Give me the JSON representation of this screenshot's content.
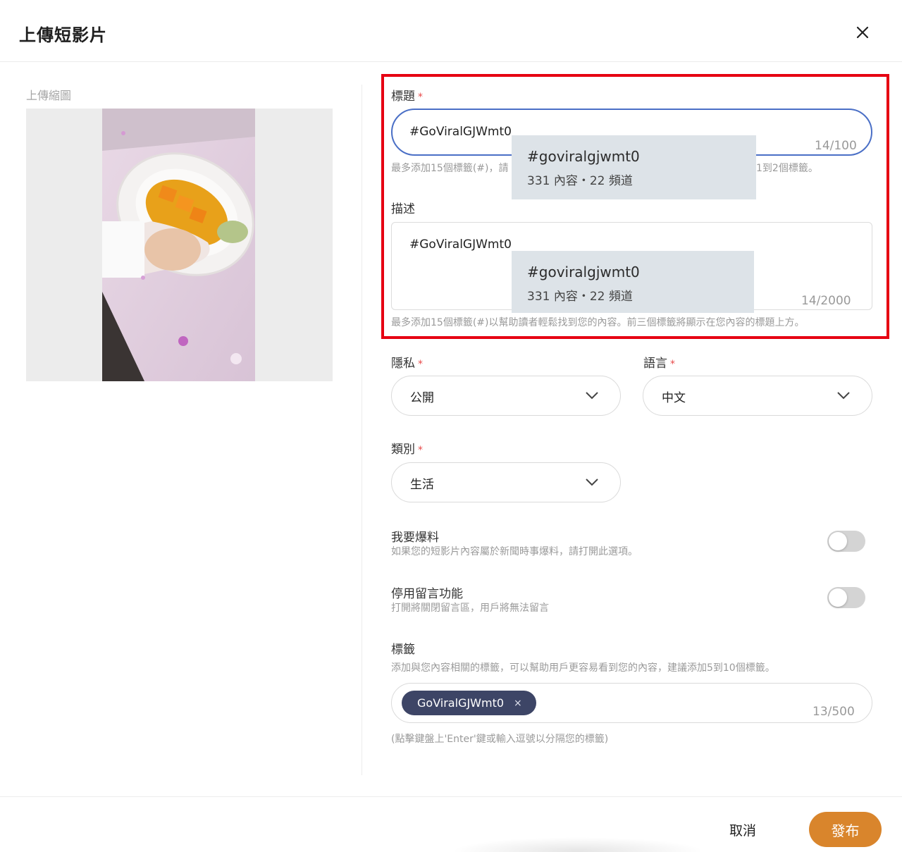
{
  "header": {
    "title": "上傳短影片"
  },
  "thumbnail": {
    "label": "上傳縮圖"
  },
  "title_field": {
    "label": "標題",
    "required_mark": "*",
    "value": "#GoViralGJWmt0",
    "counter": "14/100",
    "hint_left": "最多添加15個標籤(#)，請",
    "hint_right": "1到2個標籤。",
    "suggestion": {
      "tag": "#goviralgjwmt0",
      "meta": "331 內容・22 頻道"
    }
  },
  "description_field": {
    "label": "描述",
    "value": "#GoViralGJWmt0",
    "counter": "14/2000",
    "hint": "最多添加15個標籤(#)以幫助讀者輕鬆找到您的內容。前三個標籤將顯示在您內容的標題上方。",
    "suggestion": {
      "tag": "#goviralgjwmt0",
      "meta": "331 內容・22 頻道"
    }
  },
  "privacy": {
    "label": "隱私",
    "required_mark": "*",
    "value": "公開"
  },
  "language": {
    "label": "語言",
    "required_mark": "*",
    "value": "中文"
  },
  "category": {
    "label": "類別",
    "required_mark": "*",
    "value": "生活"
  },
  "breaking_news": {
    "title": "我要爆料",
    "desc": "如果您的短影片內容屬於新聞時事爆料，請打開此選項。",
    "enabled": false
  },
  "disable_comments": {
    "title": "停用留言功能",
    "desc": "打開將關閉留言區，用戶將無法留言",
    "enabled": false
  },
  "tags": {
    "label": "標籤",
    "desc": "添加與您內容相關的標籤，可以幫助用戶更容易看到您的內容，建議添加5到10個標籤。",
    "chips": [
      "GoViralGJWmt0"
    ],
    "chip_remove": "×",
    "counter": "13/500",
    "hint": "(點擊鍵盤上'Enter'鍵或輸入逗號以分隔您的標籤)"
  },
  "footer": {
    "cancel_label": "取消",
    "publish_label": "發布"
  },
  "colors": {
    "accent": "#d9852c",
    "focus_border": "#4a6fc6",
    "highlight": "#e60012",
    "chip_bg": "#3d4566",
    "required": "#e84b4b"
  }
}
